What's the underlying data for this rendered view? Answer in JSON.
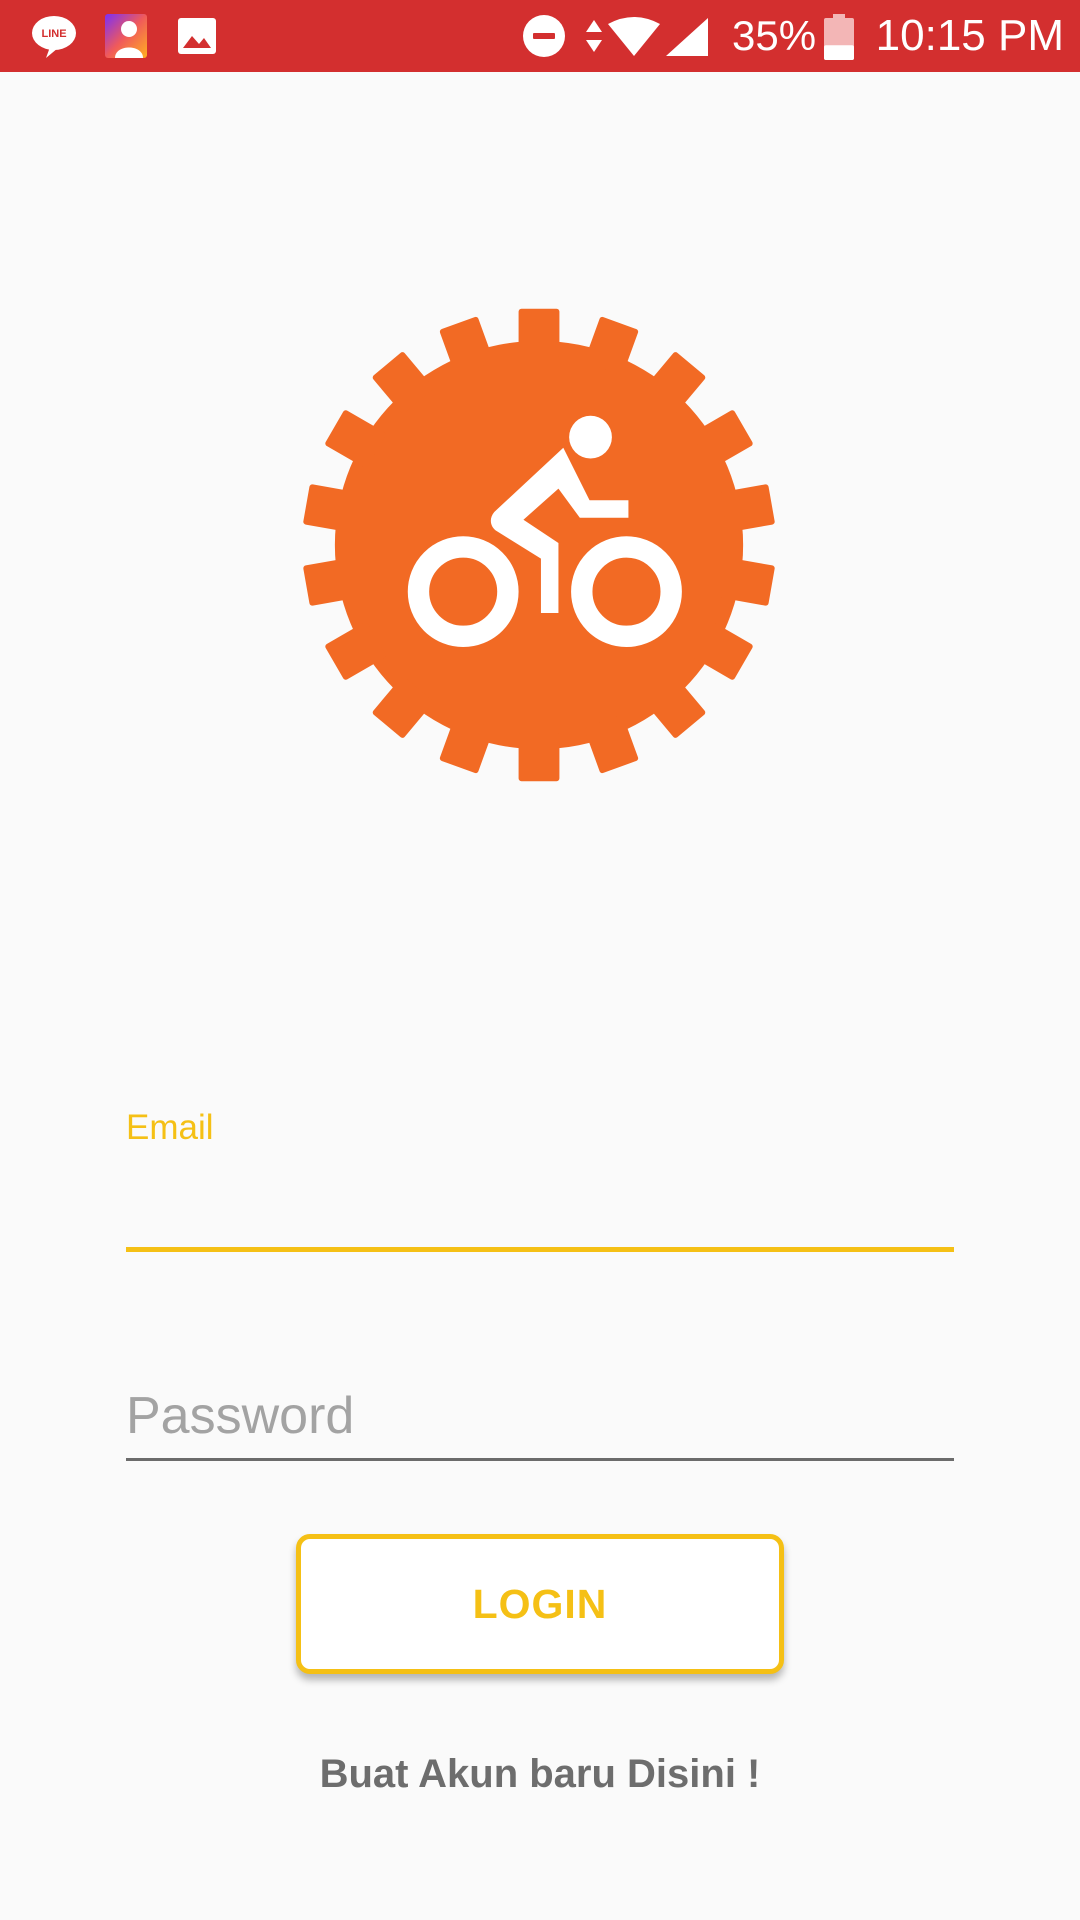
{
  "status_bar": {
    "battery_percent": "35%",
    "time": "10:15 PM",
    "icons": [
      "line-icon",
      "profile-icon",
      "gallery-icon",
      "do-not-disturb-icon",
      "data-transfer-icon",
      "wifi-icon",
      "signal-icon",
      "battery-icon"
    ],
    "line_badge_text": "LINE",
    "battery_level": 0.35,
    "background_color": "#d32f2f"
  },
  "logo": {
    "icon": "gear-bicycle-icon",
    "color": "#f26a24"
  },
  "form": {
    "email_label": "Email",
    "email_value": "",
    "password_placeholder": "Password",
    "password_value": "",
    "accent_color": "#f5c015"
  },
  "login_button": {
    "label": "LOGIN"
  },
  "register_link": {
    "label": "Buat Akun baru Disini !"
  }
}
